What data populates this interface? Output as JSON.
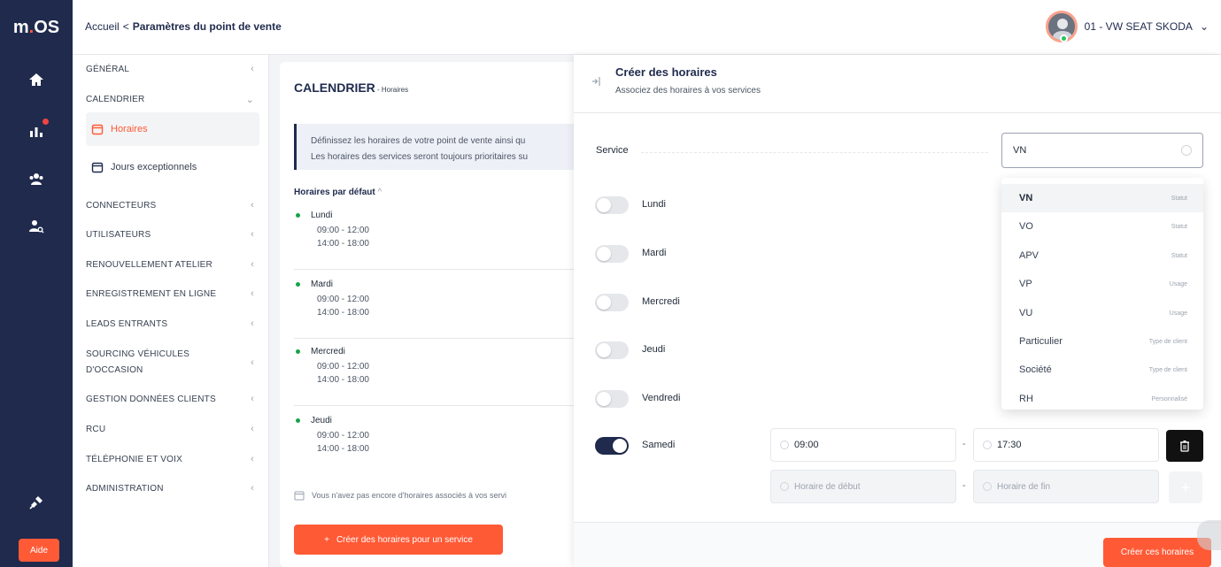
{
  "app": {
    "logo_prefix": "m",
    "logo_dot": ".",
    "logo_suffix": "OS",
    "help_label": "Aide"
  },
  "header": {
    "breadcrumb_home": "Accueil",
    "breadcrumb_sep": "<",
    "breadcrumb_current": "Paramètres du point de vente",
    "account_name": "01 - VW SEAT SKODA",
    "account_chevron": "⌄"
  },
  "settings_nav": {
    "items": [
      {
        "label": "GÉNÉRAL",
        "chev": "‹"
      },
      {
        "label": "CALENDRIER",
        "chev": "⌄"
      },
      {
        "label": "CONNECTEURS",
        "chev": "‹"
      },
      {
        "label": "UTILISATEURS",
        "chev": "‹"
      },
      {
        "label": "RENOUVELLEMENT ATELIER",
        "chev": "‹"
      },
      {
        "label": "ENREGISTREMENT EN LIGNE",
        "chev": "‹"
      },
      {
        "label": "LEADS ENTRANTS",
        "chev": "‹"
      },
      {
        "label": "SOURCING VÉHICULES D'OCCASION",
        "chev": "‹"
      },
      {
        "label": "GESTION DONNÉES CLIENTS",
        "chev": "‹"
      },
      {
        "label": "RCU",
        "chev": "‹"
      },
      {
        "label": "TÉLÉPHONIE ET VOIX",
        "chev": "‹"
      },
      {
        "label": "ADMINISTRATION",
        "chev": "‹"
      }
    ],
    "sub_items": [
      {
        "label": "Horaires"
      },
      {
        "label": "Jours exceptionnels"
      }
    ]
  },
  "main": {
    "title": "CALENDRIER",
    "title_suffix": " - Horaires",
    "info_line1": "Définissez les horaires de votre point de vente ainsi qu",
    "info_line2": "Les horaires des services seront toujours prioritaires su",
    "default_title": "Horaires par défaut",
    "default_chevron": "^",
    "days": [
      {
        "name": "Lundi",
        "slot1": "09:00 - 12:00",
        "slot2": "14:00 - 18:00"
      },
      {
        "name": "Mardi",
        "slot1": "09:00 - 12:00",
        "slot2": "14:00 - 18:00"
      },
      {
        "name": "Mercredi",
        "slot1": "09:00 - 12:00",
        "slot2": "14:00 - 18:00"
      },
      {
        "name": "Jeudi",
        "slot1": "09:00 - 12:00",
        "slot2": "14:00 - 18:00"
      }
    ],
    "empty_note": "Vous n'avez pas encore d'horaires associés à vos servi",
    "create_button_plus": "+",
    "create_button_label": "Créer des horaires pour un service"
  },
  "drawer": {
    "title": "Créer des horaires",
    "subtitle": "Associez des horaires à vos services",
    "service_label": "Service",
    "service_value": "VN",
    "days": [
      {
        "name": "Lundi",
        "enabled": false
      },
      {
        "name": "Mardi",
        "enabled": false
      },
      {
        "name": "Mercredi",
        "enabled": false
      },
      {
        "name": "Jeudi",
        "enabled": false
      },
      {
        "name": "Vendredi",
        "enabled": false
      },
      {
        "name": "Samedi",
        "enabled": true
      }
    ],
    "samedi_start": "09:00",
    "samedi_end": "17:30",
    "dash": "-",
    "start_placeholder": "Horaire de début",
    "end_placeholder": "Horaire de fin",
    "plus_label": "+",
    "submit_label": "Créer ces horaires"
  },
  "dropdown": {
    "options": [
      {
        "label": "VN",
        "tag": "Statut",
        "selected": true
      },
      {
        "label": "VO",
        "tag": "Statut"
      },
      {
        "label": "APV",
        "tag": "Statut"
      },
      {
        "label": "VP",
        "tag": "Usage"
      },
      {
        "label": "VU",
        "tag": "Usage"
      },
      {
        "label": "Particulier",
        "tag": "Type de client"
      },
      {
        "label": "Société",
        "tag": "Type de client"
      },
      {
        "label": "RH",
        "tag": "Personnalisé"
      }
    ]
  },
  "colors": {
    "brand_navy": "#1f2a4d",
    "accent_orange": "#ff5a36",
    "status_green": "#16a34a"
  }
}
